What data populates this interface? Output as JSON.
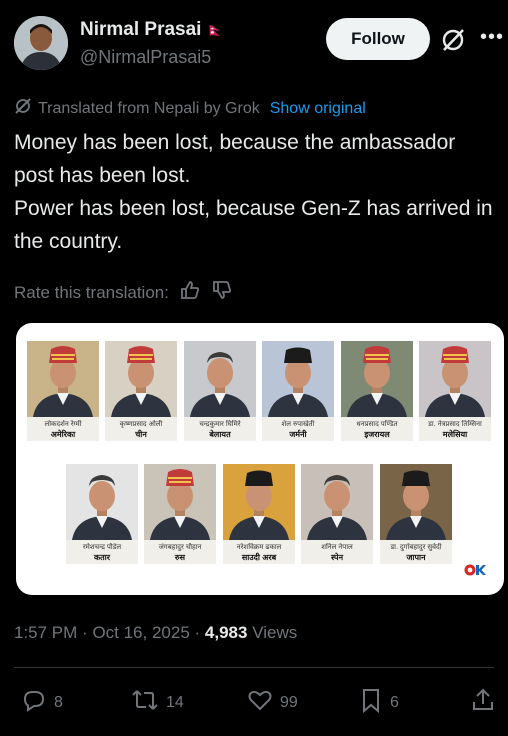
{
  "user": {
    "name": "Nirmal Prasai",
    "flag": "🇳🇵",
    "handle": "@NirmalPrasai5",
    "follow_label": "Follow"
  },
  "translation": {
    "label": "Translated from Nepali by Grok",
    "show_original": "Show original",
    "rate_label": "Rate this translation:"
  },
  "post": {
    "text": "Money has been lost, because the ambassador post has been lost.\nPower has been lost, because Gen-Z has arrived in the country."
  },
  "image": {
    "people": [
      {
        "name": "लोकदर्शन रेग्मी",
        "country": "अमेरिका",
        "bg": "#c9b48a",
        "cap": "dhaka"
      },
      {
        "name": "कृष्णप्रसाद ओली",
        "country": "चीन",
        "bg": "#d8d0c2",
        "cap": "dhaka"
      },
      {
        "name": "चन्द्रकुमार घिमिरे",
        "country": "बेलायत",
        "bg": "#c7c9cc",
        "cap": "none"
      },
      {
        "name": "शेल रुपाखेती",
        "country": "जर्मनी",
        "bg": "#b9c4d6",
        "cap": "black"
      },
      {
        "name": "धनप्रसाद पण्डित",
        "country": "इजरायल",
        "bg": "#7f8a74",
        "cap": "dhaka"
      },
      {
        "name": "डा. नेत्रप्रसाद तिम्सिना",
        "country": "मलेसिया",
        "bg": "#c9c4c8",
        "cap": "dhaka"
      },
      {
        "name": "रमेशचन्द्र पौडेल",
        "country": "कतार",
        "bg": "#e4e4e4",
        "cap": "none"
      },
      {
        "name": "जंगबहादुर चौहान",
        "country": "रुस",
        "bg": "#c9c3b8",
        "cap": "dhaka"
      },
      {
        "name": "नरेशविक्रम ढकाल",
        "country": "साउदी अरब",
        "bg": "#d9a23c",
        "cap": "black"
      },
      {
        "name": "शनिल नेपाल",
        "country": "स्पेन",
        "bg": "#c8c0b8",
        "cap": "none"
      },
      {
        "name": "डा. दुर्गाबहादुर सुवेदी",
        "country": "जापान",
        "bg": "#7a6448",
        "cap": "black"
      }
    ],
    "logo_text": "OK"
  },
  "meta": {
    "time": "1:57 PM",
    "date": "Oct 16, 2025",
    "views_count": "4,983",
    "views_label": "Views"
  },
  "actions": {
    "replies": "8",
    "reposts": "14",
    "likes": "99",
    "bookmarks": "6"
  },
  "icons": [
    "grok-icon",
    "more-icon",
    "thumbs-up-icon",
    "thumbs-down-icon",
    "reply-icon",
    "repost-icon",
    "like-icon",
    "bookmark-icon",
    "share-icon"
  ],
  "colors": {
    "link": "#1d9bf0",
    "muted": "#71767b",
    "text": "#e7e9ea"
  }
}
